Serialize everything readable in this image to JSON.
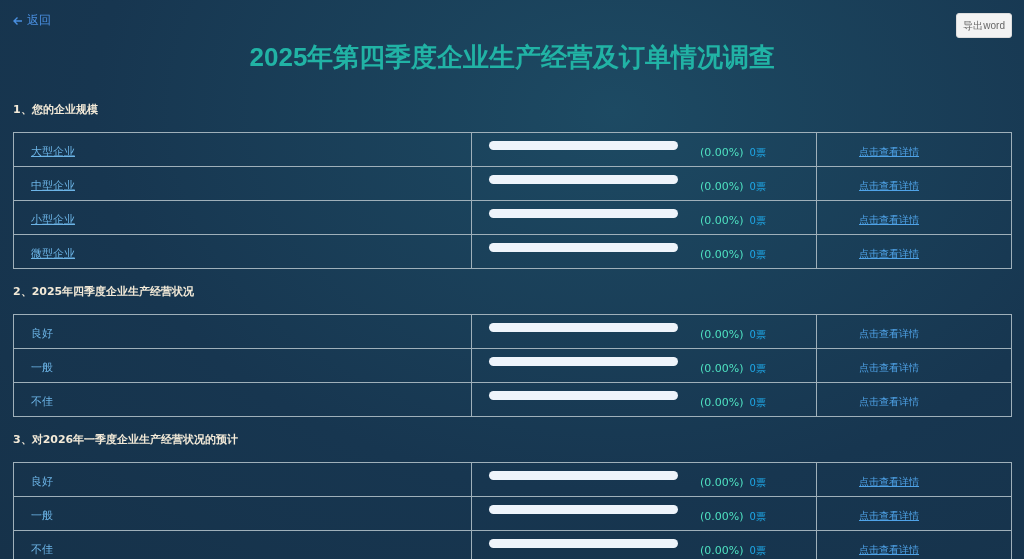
{
  "back_link": "返回",
  "export_button": "导出word",
  "title": "2025年第四季度企业生产经营及订单情况调查",
  "questions": [
    {
      "heading": "1、您的企业规模",
      "options": [
        {
          "label": "大型企业",
          "label_underlined": true,
          "level": 0,
          "percent": "(0.00%)",
          "votes": "0票",
          "detail": "点击查看详情",
          "detail_underlined": true
        },
        {
          "label": "中型企业",
          "label_underlined": true,
          "level": 0,
          "percent": "(0.00%)",
          "votes": "0票",
          "detail": "点击查看详情",
          "detail_underlined": true
        },
        {
          "label": "小型企业",
          "label_underlined": true,
          "level": 0,
          "percent": "(0.00%)",
          "votes": "0票",
          "detail": "点击查看详情",
          "detail_underlined": true
        },
        {
          "label": "微型企业",
          "label_underlined": true,
          "level": 0,
          "percent": "(0.00%)",
          "votes": "0票",
          "detail": "点击查看详情",
          "detail_underlined": true
        }
      ]
    },
    {
      "heading": "2、2025年四季度企业生产经营状况",
      "options": [
        {
          "label": "良好",
          "label_underlined": false,
          "level": 0,
          "percent": "(0.00%)",
          "votes": "0票",
          "detail": "点击查看详情",
          "detail_underlined": false
        },
        {
          "label": "一般",
          "label_underlined": false,
          "level": 0,
          "percent": "(0.00%)",
          "votes": "0票",
          "detail": "点击查看详情",
          "detail_underlined": false
        },
        {
          "label": "不佳",
          "label_underlined": false,
          "level": 0,
          "percent": "(0.00%)",
          "votes": "0票",
          "detail": "点击查看详情",
          "detail_underlined": false
        }
      ]
    },
    {
      "heading": "3、对2026年一季度企业生产经营状况的预计",
      "options": [
        {
          "label": "良好",
          "label_underlined": false,
          "level": 0,
          "percent": "(0.00%)",
          "votes": "0票",
          "detail": "点击查看详情",
          "detail_underlined": true
        },
        {
          "label": "一般",
          "label_underlined": false,
          "level": 0,
          "percent": "(0.00%)",
          "votes": "0票",
          "detail": "点击查看详情",
          "detail_underlined": true
        },
        {
          "label": "不佳",
          "label_underlined": false,
          "level": 0,
          "percent": "(0.00%)",
          "votes": "0票",
          "detail": "点击查看详情",
          "detail_underlined": true
        }
      ]
    }
  ]
}
